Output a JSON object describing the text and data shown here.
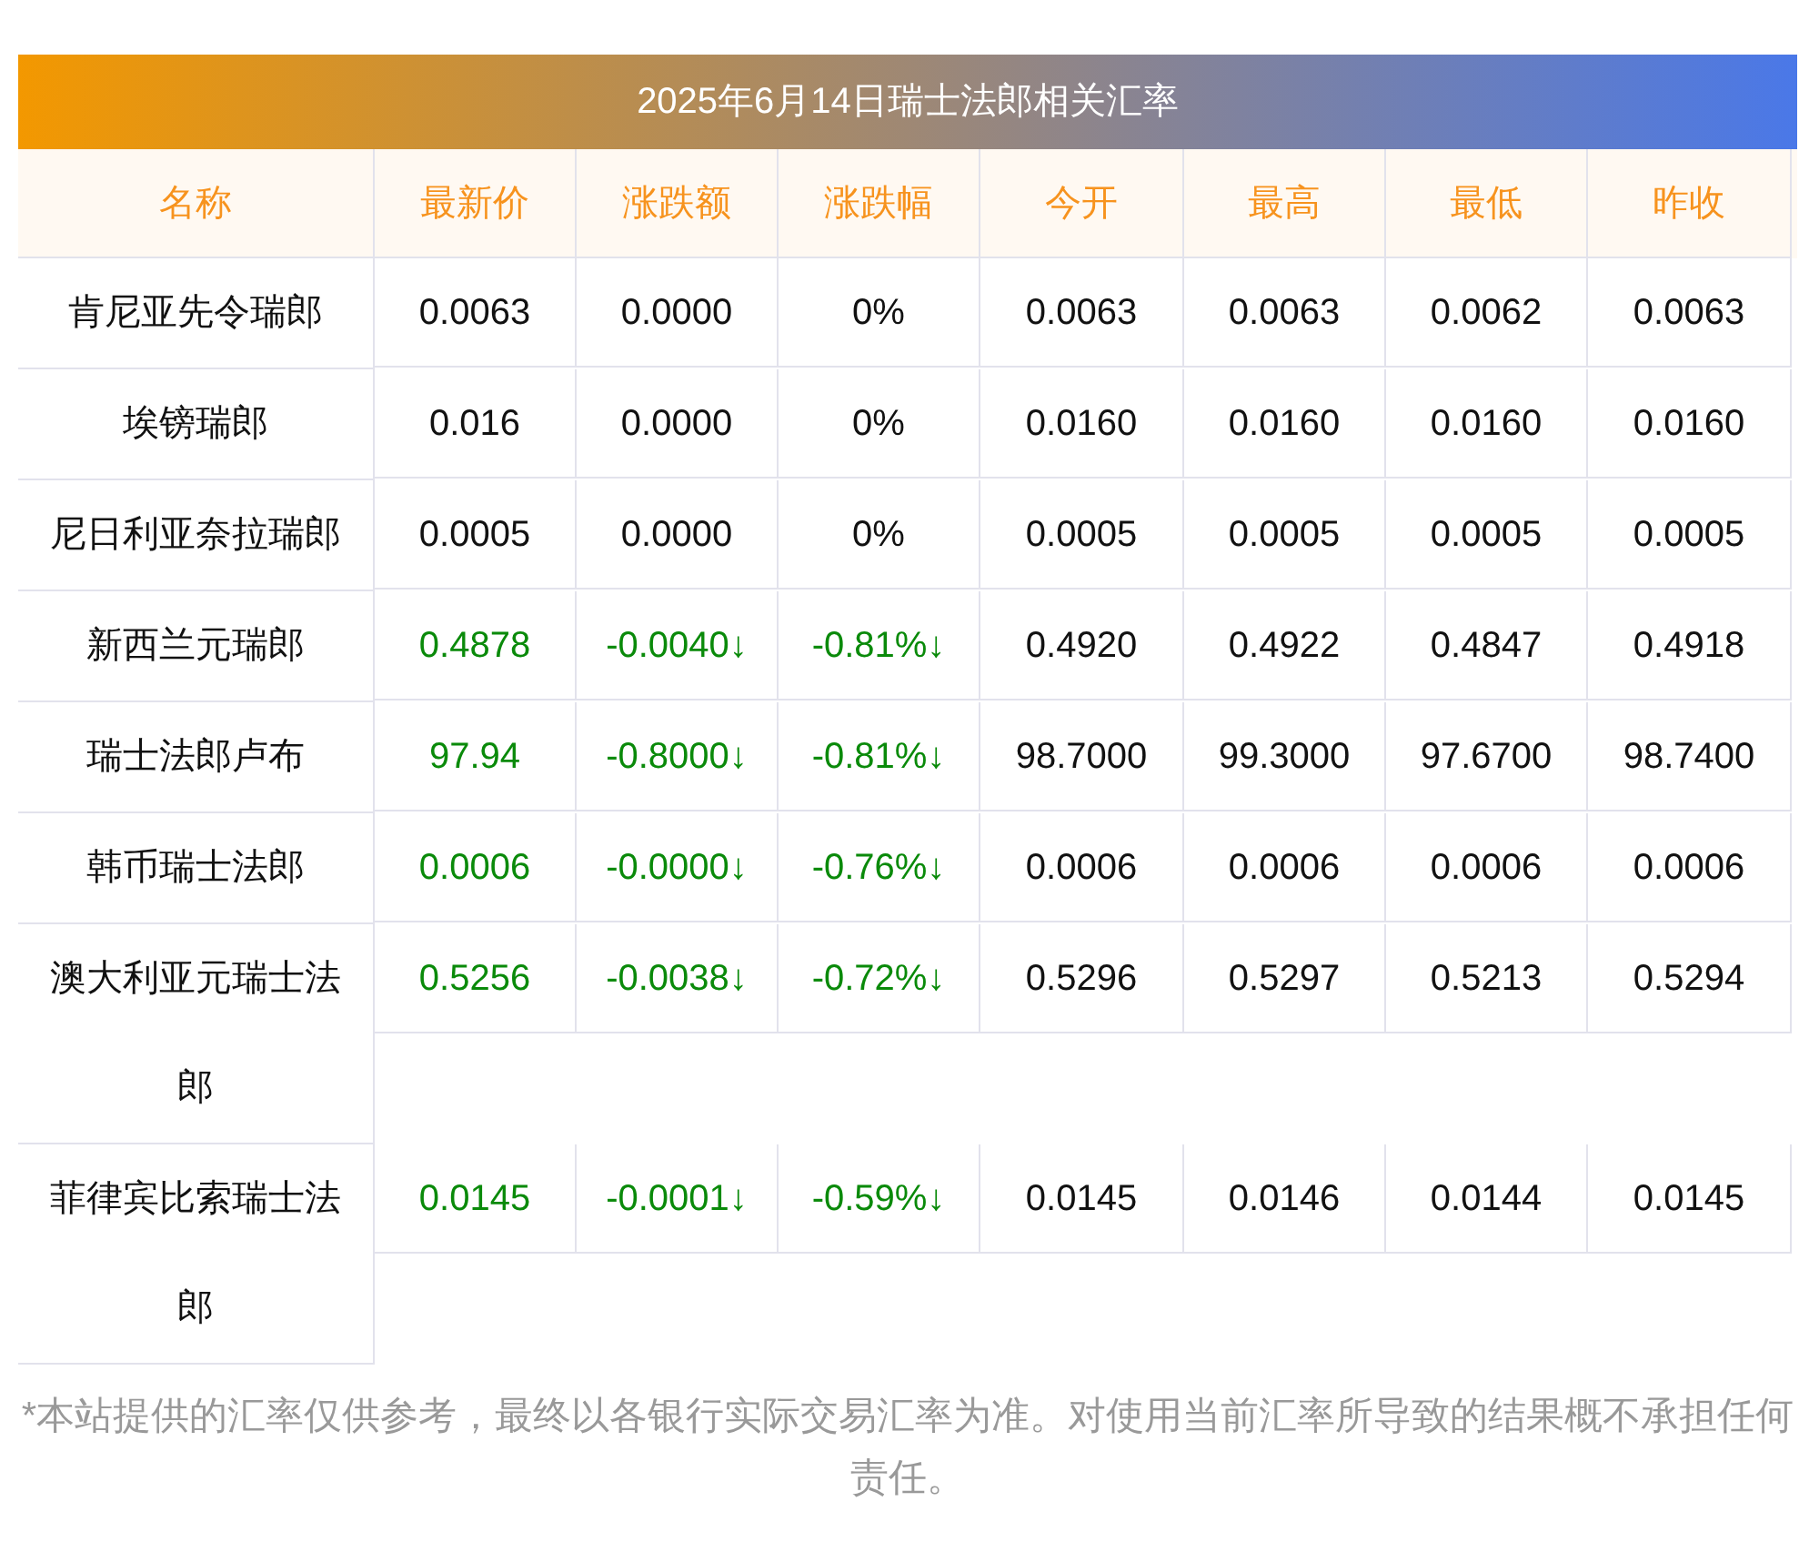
{
  "table": {
    "title": "2025年6月14日瑞士法郎相关汇率",
    "columns": [
      "名称",
      "最新价",
      "涨跌额",
      "涨跌幅",
      "今开",
      "最高",
      "最低",
      "昨收"
    ],
    "rows": [
      {
        "kind": "flat",
        "cells": [
          "肯尼亚先令瑞郎",
          "0.0063",
          "0.0000",
          "0%",
          "0.0063",
          "0.0063",
          "0.0062",
          "0.0063"
        ]
      },
      {
        "kind": "flat",
        "cells": [
          "埃镑瑞郎",
          "0.016",
          "0.0000",
          "0%",
          "0.0160",
          "0.0160",
          "0.0160",
          "0.0160"
        ]
      },
      {
        "kind": "flat",
        "cells": [
          "尼日利亚奈拉瑞郎",
          "0.0005",
          "0.0000",
          "0%",
          "0.0005",
          "0.0005",
          "0.0005",
          "0.0005"
        ]
      },
      {
        "kind": "down",
        "cells": [
          "新西兰元瑞郎",
          "0.4878",
          "-0.0040↓",
          "-0.81%↓",
          "0.4920",
          "0.4922",
          "0.4847",
          "0.4918"
        ]
      },
      {
        "kind": "down",
        "cells": [
          "瑞士法郎卢布",
          "97.94",
          "-0.8000↓",
          "-0.81%↓",
          "98.7000",
          "99.3000",
          "97.6700",
          "98.7400"
        ]
      },
      {
        "kind": "down",
        "cells": [
          "韩币瑞士法郎",
          "0.0006",
          "-0.0000↓",
          "-0.76%↓",
          "0.0006",
          "0.0006",
          "0.0006",
          "0.0006"
        ]
      },
      {
        "kind": "down",
        "cells": [
          "澳大利亚元瑞士法郎",
          "0.5256",
          "-0.0038↓",
          "-0.72%↓",
          "0.5296",
          "0.5297",
          "0.5213",
          "0.5294"
        ]
      },
      {
        "kind": "down",
        "cells": [
          "菲律宾比索瑞士法郎",
          "0.0145",
          "-0.0001↓",
          "-0.59%↓",
          "0.0145",
          "0.0146",
          "0.0144",
          "0.0145"
        ]
      }
    ]
  },
  "disclaimer": "*本站提供的汇率仅供参考，最终以各银行实际交易汇率为准。对使用当前汇率所导致的结果概不承担任何责任。"
}
